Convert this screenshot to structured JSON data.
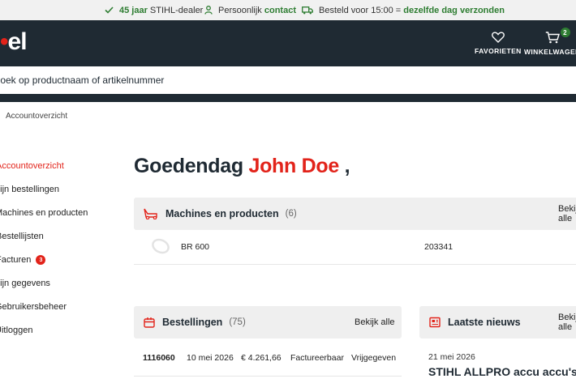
{
  "usp": {
    "dealer": {
      "highlight": "45 jaar",
      "text": " STIHL-dealer"
    },
    "contact": {
      "text": "Persoonlijk ",
      "highlight": "contact"
    },
    "shipping": {
      "text": "Besteld voor 15:00 = ",
      "highlight": "dezelfde dag verzonden"
    }
  },
  "header": {
    "logo_text": "el",
    "favorites_label": "FAVORIETEN",
    "cart_label": "WINKELWAGEN",
    "cart_count": "2"
  },
  "search": {
    "placeholder": "Zoek op productnaam of artikelnummer"
  },
  "breadcrumb": {
    "current": "Accountoverzicht"
  },
  "sidebar": {
    "items": [
      {
        "label": "Accountoverzicht"
      },
      {
        "label": "Mijn bestellingen"
      },
      {
        "label": "Machines en producten"
      },
      {
        "label": "Bestellijsten"
      },
      {
        "label": "Facturen",
        "badge": "3"
      },
      {
        "label": "Mijn gegevens"
      },
      {
        "label": "Gebruikersbeheer"
      },
      {
        "label": "Uitloggen"
      }
    ]
  },
  "greeting": {
    "prefix": "Goedendag ",
    "name": "John Doe",
    "suffix": " ,"
  },
  "machines": {
    "title": "Machines en producten",
    "count": "(6)",
    "link": "Bekijk alle",
    "rows": [
      {
        "name": "BR 600",
        "number": "203341"
      }
    ]
  },
  "orders": {
    "title": "Bestellingen",
    "count": "(75)",
    "link": "Bekijk alle",
    "rows": [
      {
        "number": "1116060",
        "date": "10 mei 2026",
        "amount": "€ 4.261,66",
        "invoice": "Factureerbaar",
        "status": "Vrijgegeven"
      }
    ]
  },
  "news": {
    "title": "Laatste nieuws",
    "link": "Bekijk alle",
    "items": [
      {
        "date": "21 mei 2026",
        "title": "STIHL ALLPRO accu accu's:"
      }
    ]
  },
  "colors": {
    "brand_red": "#e2231a",
    "header_dark": "#1f2a33",
    "usp_green": "#2e7d32"
  }
}
